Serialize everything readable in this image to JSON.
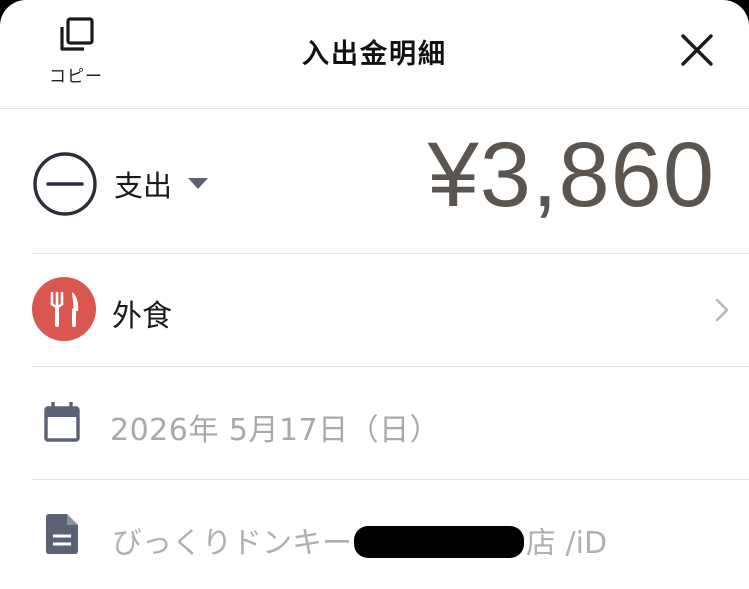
{
  "header": {
    "copy_label": "コピー",
    "title": "入出金明細",
    "copy_icon": "copy-icon",
    "close_icon": "close-icon"
  },
  "transaction": {
    "type_label": "支出",
    "type_icon": "minus-circle-icon",
    "amount": "¥3,860",
    "category": {
      "label": "外食",
      "icon": "fork-knife-icon",
      "icon_color": "#d9574f"
    },
    "date": "2026年 5月17日（日）",
    "memo": {
      "prefix": "びっくりドンキー",
      "suffix": "店 /iD",
      "redacted": true
    }
  },
  "colors": {
    "amount": "#5a5550",
    "muted_text": "#a9a9a9",
    "icon_slate": "#5b6275"
  }
}
